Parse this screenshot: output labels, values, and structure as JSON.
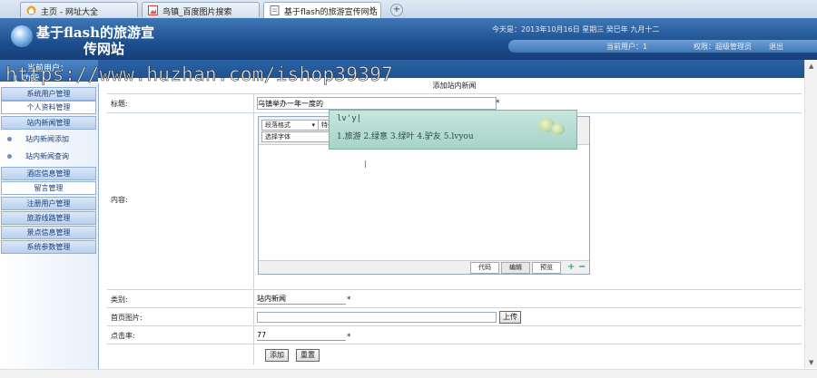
{
  "browser": {
    "tabs": [
      {
        "label": "主页 - 网址大全"
      },
      {
        "label": "鸟镇_百度图片搜索"
      },
      {
        "label": "基于flash的旅游宣传网站"
      }
    ]
  },
  "header": {
    "title_line1": "基于flash的旅游宣",
    "title_line2": "传网站",
    "date": "今天是：2013年10月16日 星期三 癸巳年 九月十二",
    "current_user": "当前用户：1",
    "permission": "权限：超级管理员",
    "logout": "退出"
  },
  "sidebar": {
    "head_line1": "当前用户：",
    "head_line2": "1 功能",
    "items": [
      {
        "label": "系统用户管理"
      },
      {
        "label": "个人资料管理"
      },
      {
        "label": "站内新闻管理"
      },
      {
        "label": "站内新闻添加"
      },
      {
        "label": "站内新闻查询"
      },
      {
        "label": "酒店信息管理"
      },
      {
        "label": "留言管理"
      },
      {
        "label": "注册用户管理"
      },
      {
        "label": "旅游线路管理"
      },
      {
        "label": "景点信息管理"
      },
      {
        "label": "系统参数管理"
      }
    ]
  },
  "watermark": "https://www.huzhan.com/ishop39397",
  "form": {
    "title": "添加站内新闻",
    "title_label": "标题:",
    "title_value": "乌镇举办一年一度的",
    "content_label": "内容:",
    "category_label": "类别:",
    "category_value": "站内新闻",
    "image_label": "首页图片:",
    "image_value": "",
    "upload_button": "上传",
    "clicks_label": "点击率:",
    "clicks_value": "77",
    "required_mark": "*",
    "submit_button": "添加",
    "reset_button": "重置"
  },
  "editor": {
    "paragraph_select": "段落格式",
    "special_select": "特殊",
    "font_select": "选择字体",
    "tab_code": "代码",
    "tab_edit": "编辑",
    "tab_preview": "预览"
  },
  "ime": {
    "composition": "lv'y|",
    "candidates": "1.旅游  2.绿意  3.绿叶  4.驴友  5.lvyou"
  },
  "icons": [
    "browser-home-icon",
    "image-page-icon",
    "site-page-icon",
    "new-tab-icon",
    "close-tab-icon",
    "bullet-icon",
    "zoom-in-icon",
    "zoom-out-icon",
    "heart-decoration-icon"
  ]
}
